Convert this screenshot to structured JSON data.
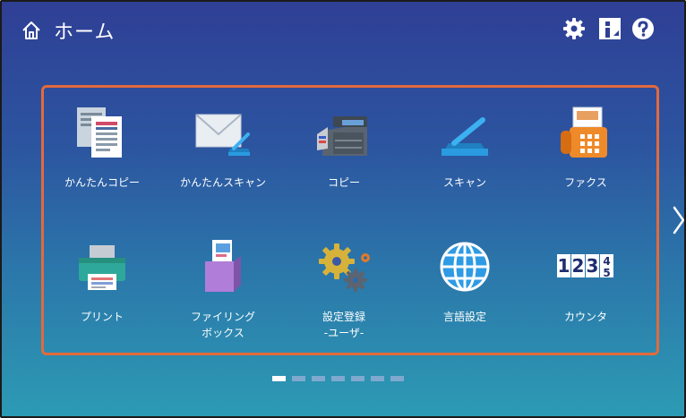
{
  "header": {
    "title": "ホーム"
  },
  "tiles": [
    {
      "label": "かんたんコピー"
    },
    {
      "label": "かんたんスキャン"
    },
    {
      "label": "コピー"
    },
    {
      "label": "スキャン"
    },
    {
      "label": "ファクス"
    },
    {
      "label": "プリント"
    },
    {
      "label": "ファイリング\nボックス"
    },
    {
      "label": "設定登録\n-ユーザ-"
    },
    {
      "label": "言語設定"
    },
    {
      "label": "カウンタ"
    }
  ],
  "counter_digits": {
    "d1": "1",
    "d2": "2",
    "d3": "3",
    "d4a": "4",
    "d4b": "5"
  },
  "pagination": {
    "pages": 7,
    "current": 1
  },
  "colors": {
    "accent_border": "#e26a3c"
  }
}
